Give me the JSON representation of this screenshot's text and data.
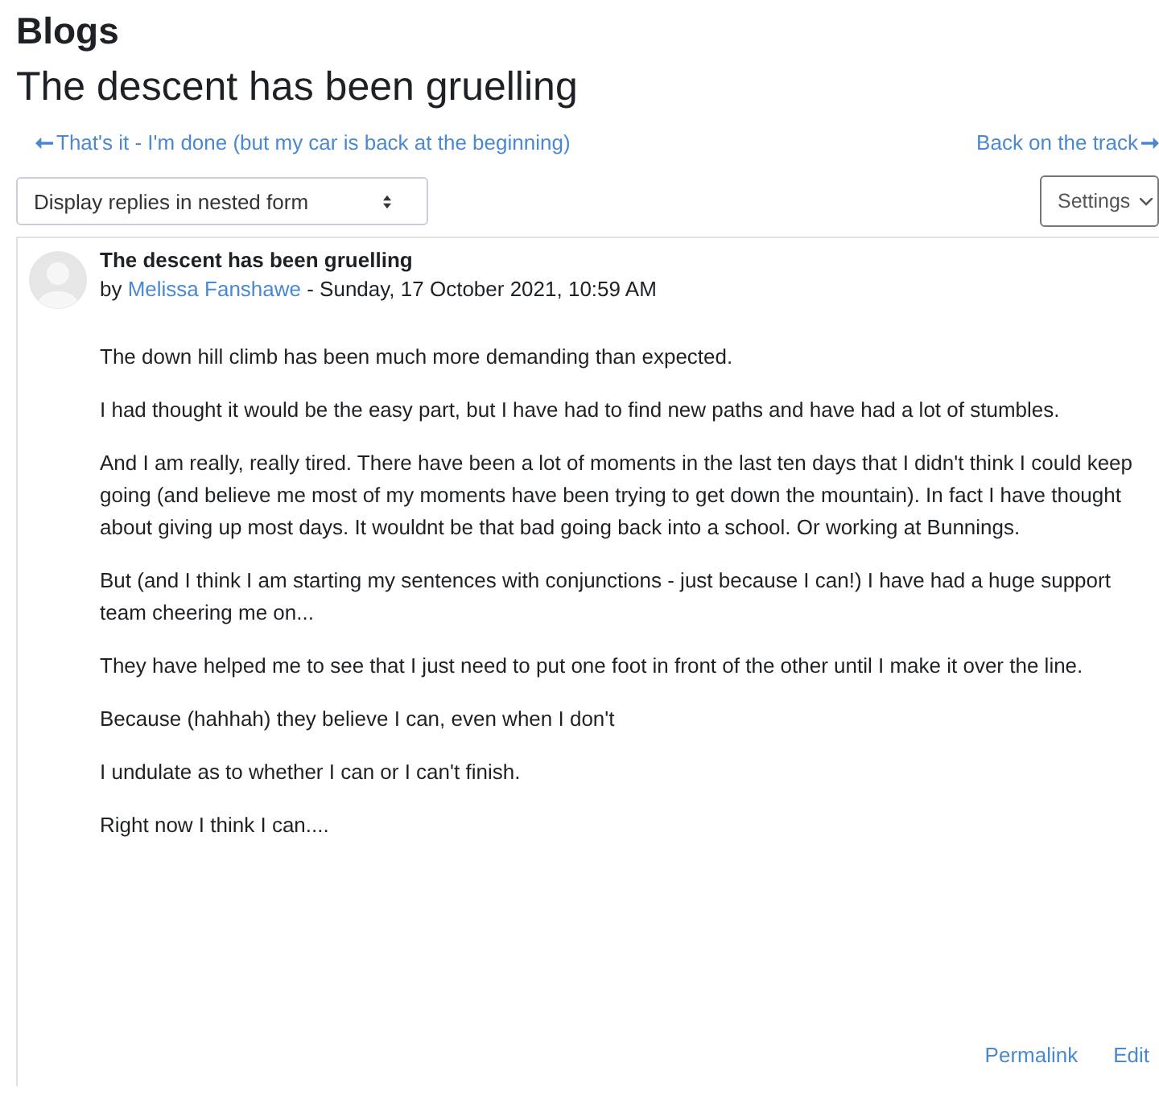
{
  "page_title": "Blogs",
  "entry_heading": "The descent has been gruelling",
  "nav": {
    "previous": "That's it - I'm done (but my car is back at the beginning)",
    "next": "Back on the track"
  },
  "display_select": {
    "value": "Display replies in nested form"
  },
  "settings_button": "Settings",
  "post": {
    "title": "The descent has been gruelling",
    "by": "by",
    "author": "Melissa Fanshawe",
    "date": " - Sunday, 17 October 2021, 10:59 AM",
    "paragraphs": [
      "The down hill climb has been much more demanding than expected.",
      "I had thought it would be the easy part, but I have had to find new paths and have had a lot of stumbles.",
      "And I am really, really tired. There have been a lot of moments in the last ten days that I didn't think I could keep going (and believe me most of my moments have been trying to get down the mountain). In fact I have thought about giving up most days. It wouldnt be that bad going back into a school. Or working at Bunnings.",
      "But (and I think I am starting my sentences with conjunctions - just because I can!) I have had a huge support team cheering me on...",
      "They have helped me to see that I just need to put one foot in front of the other until I make it over the line.",
      "Because (hahhah) they believe I can, even when I don't",
      "I undulate as to whether I can or I can't finish.",
      "Right now I think I can...."
    ],
    "actions": [
      "Permalink",
      "Edit"
    ]
  }
}
